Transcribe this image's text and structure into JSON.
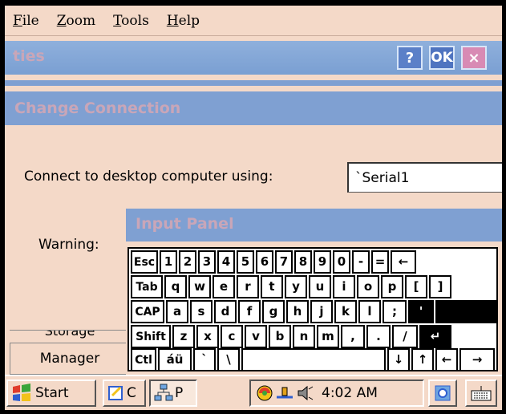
{
  "menu": {
    "file": {
      "first": "F",
      "rest": "ile"
    },
    "zoom": {
      "first": "Z",
      "rest": "oom"
    },
    "tools": {
      "first": "T",
      "rest": "ools"
    },
    "help": {
      "first": "H",
      "rest": "elp"
    }
  },
  "window": {
    "title": "ties",
    "help_label": "?",
    "ok_label": "OK",
    "close_label": "×"
  },
  "section": {
    "heading": "Change Connection"
  },
  "form": {
    "connect_label": "Connect to desktop computer using:",
    "connect_value": "`Serial1",
    "warning_label": "Warning:"
  },
  "background_items": {
    "storage_label": "Storage",
    "manager_label": "Manager"
  },
  "input_panel": {
    "title": "Input Panel",
    "rows": [
      [
        "Esc",
        "1",
        "2",
        "3",
        "4",
        "5",
        "6",
        "7",
        "8",
        "9",
        "0",
        "-",
        "=",
        "←"
      ],
      [
        "Tab",
        "q",
        "w",
        "e",
        "r",
        "t",
        "y",
        "u",
        "i",
        "o",
        "p",
        "[",
        "]"
      ],
      [
        "CAP",
        "a",
        "s",
        "d",
        "f",
        "g",
        "h",
        "j",
        "k",
        "l",
        ";",
        "'"
      ],
      [
        "Shift",
        "z",
        "x",
        "c",
        "v",
        "b",
        "n",
        "m",
        ",",
        ".",
        "/",
        "↵"
      ],
      [
        "Ctl",
        "áü",
        "`",
        "\\",
        "",
        "↓",
        "↑",
        "←",
        "→"
      ]
    ]
  },
  "taskbar": {
    "start_label": "Start",
    "task1_label": "C",
    "task2_label": "P",
    "clock": "4:02 AM"
  }
}
